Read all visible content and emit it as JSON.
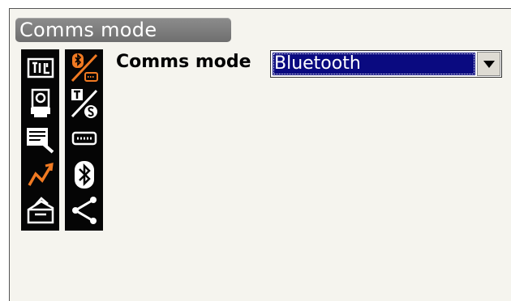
{
  "screen": {
    "title": "Comms mode"
  },
  "sidebar": {
    "left_icons": [
      "measure-mode-icon",
      "instrument-icon",
      "data-edit-icon",
      "traverse-icon",
      "toolbox-icon"
    ],
    "right_icons": [
      "bluetooth-rs232c-icon",
      "t-s-mode-icon",
      "rs232c-port-icon",
      "bluetooth-icon",
      "share-icon"
    ]
  },
  "form": {
    "comms_mode_label": "Comms mode",
    "comms_mode_value": "Bluetooth"
  },
  "colors": {
    "title_bar": "#7c7c7c",
    "screen_bg": "#f5f4ee",
    "selection_bg": "#0a0a80",
    "accent_orange": "#f07a22"
  }
}
